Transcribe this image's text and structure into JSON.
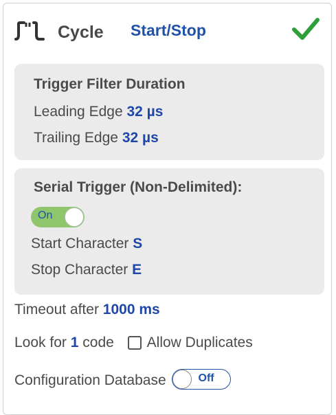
{
  "header": {
    "title": "Cycle",
    "mode_label": "Start/Stop",
    "icon": "cycle-pulse-icon",
    "status_icon": "checkmark-icon",
    "accent_color": "#1f52a8",
    "check_color": "#2e9e3a"
  },
  "trigger_filter": {
    "title": "Trigger Filter Duration",
    "leading_label": "Leading Edge",
    "leading_value": "32 µs",
    "trailing_label": "Trailing Edge",
    "trailing_value": "32 µs"
  },
  "serial_trigger": {
    "title": "Serial Trigger (Non-Delimited):",
    "toggle_label": "On",
    "start_label": "Start Character",
    "start_value": "S",
    "stop_label": "Stop Character",
    "stop_value": "E"
  },
  "timeout": {
    "label": "Timeout after",
    "value": "1000 ms"
  },
  "lookfor": {
    "prefix": "Look for",
    "count": "1",
    "suffix": "code",
    "allow_duplicates_label": "Allow Duplicates"
  },
  "config_db": {
    "label": "Configuration Database",
    "toggle_label": "Off"
  }
}
